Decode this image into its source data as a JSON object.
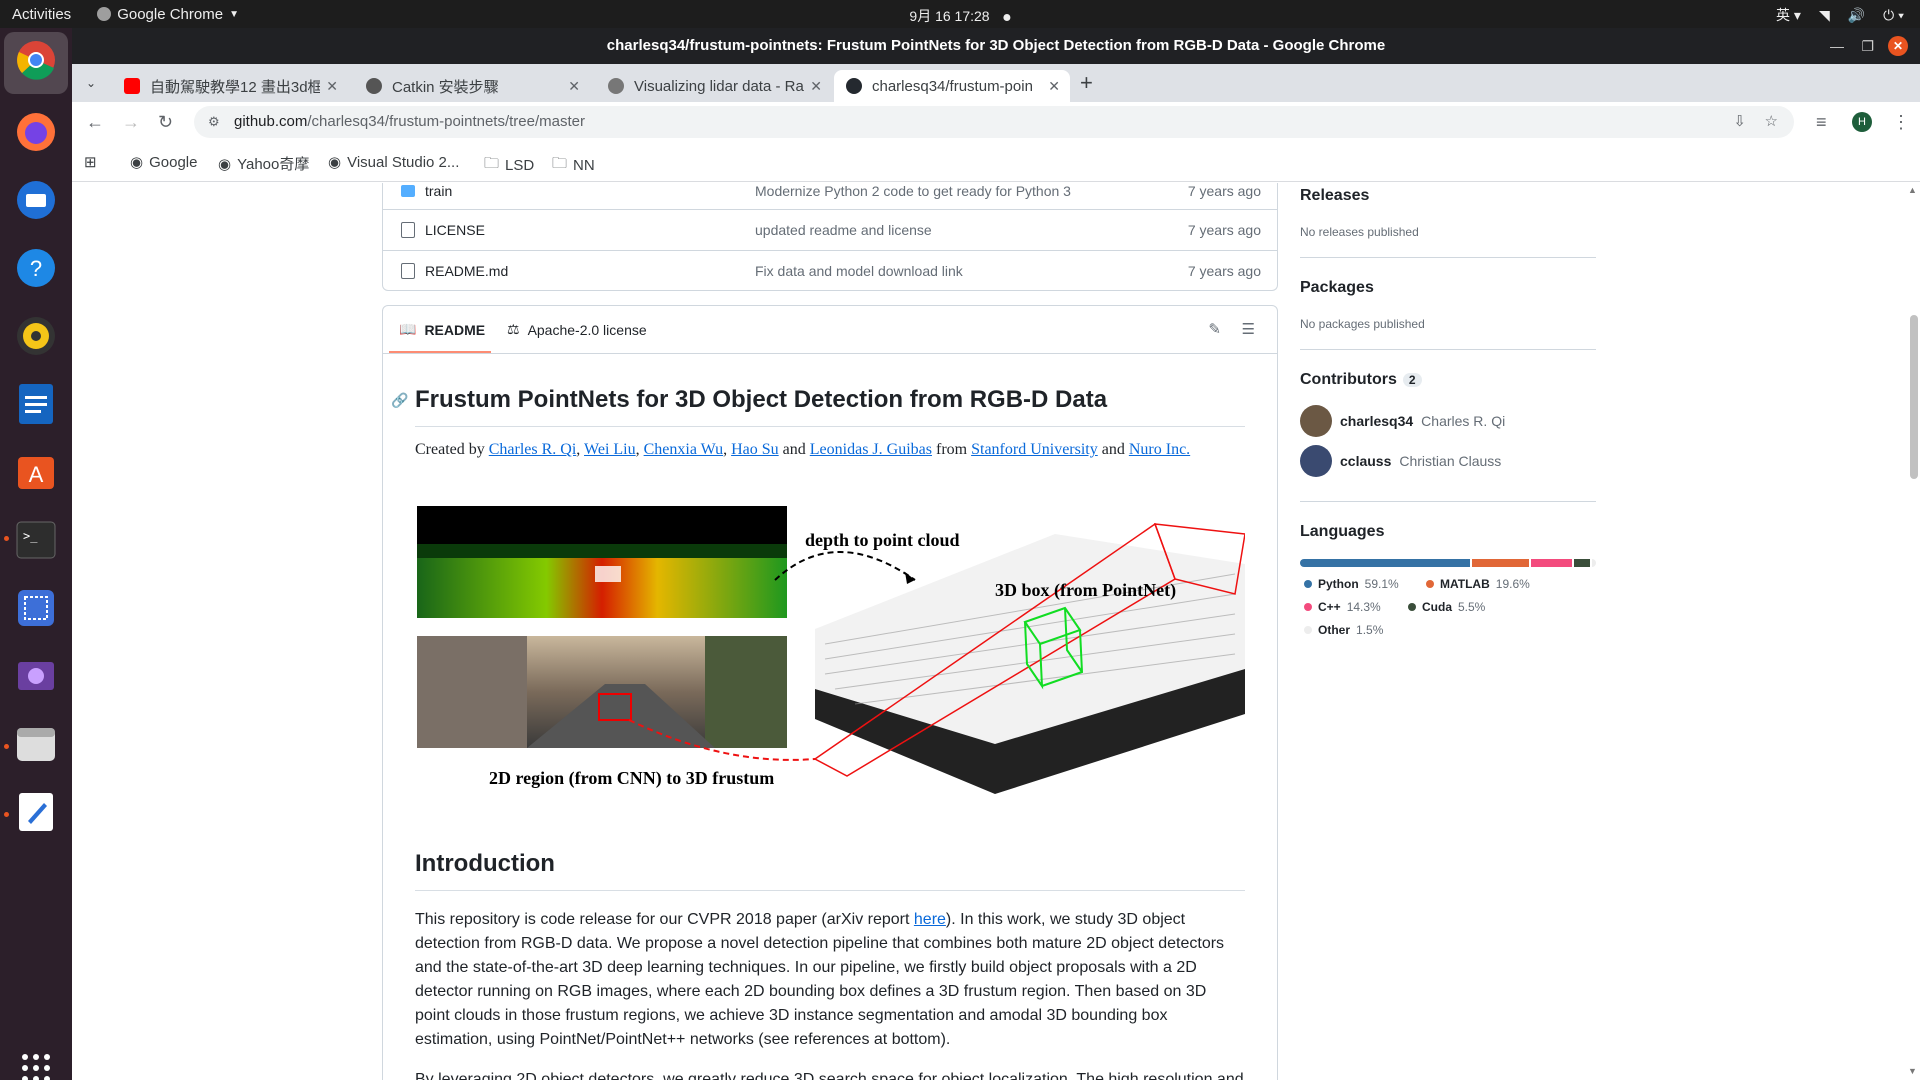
{
  "topbar": {
    "activities": "Activities",
    "app_name": "Google Chrome",
    "clock": "9月 16  17:28",
    "input_method": "英"
  },
  "window": {
    "title": "charlesq34/frustum-pointnets: Frustum PointNets for 3D Object Detection from RGB-D Data - Google Chrome"
  },
  "tabs": [
    {
      "title": "自動駕駛教學12 畫出3d框",
      "icon": "youtube-icon",
      "color": "#ff0000"
    },
    {
      "title": "Catkin 安裝步驟",
      "icon": "catkin-icon",
      "color": "#555555"
    },
    {
      "title": "Visualizing lidar data - Ra",
      "icon": "globe-icon",
      "color": "#777777"
    },
    {
      "title": "charlesq34/frustum-poin",
      "icon": "github-icon",
      "color": "#24292f"
    }
  ],
  "omnibox": {
    "host": "github.com",
    "path": "/charlesq34/frustum-pointnets/tree/master"
  },
  "bookmarks": [
    "Google",
    "Yahoo奇摩",
    "Visual Studio 2...",
    "LSD",
    "NN"
  ],
  "files": [
    {
      "name": "train",
      "message": "Modernize Python 2 code to get ready for Python 3",
      "age": "7 years ago",
      "type": "folder"
    },
    {
      "name": "LICENSE",
      "message": "updated readme and license",
      "age": "7 years ago",
      "type": "file"
    },
    {
      "name": "README.md",
      "message": "Fix data and model download link",
      "age": "7 years ago",
      "type": "file"
    }
  ],
  "readme": {
    "tab_readme": "README",
    "tab_license": "Apache-2.0 license",
    "title": "Frustum PointNets for 3D Object Detection from RGB-D Data",
    "created_by": "Created by",
    "authors": [
      "Charles R. Qi",
      "Wei Liu",
      "Chenxia Wu",
      "Hao Su",
      "Leonidas J. Guibas"
    ],
    "and": "and",
    "from": "from",
    "inst1": "Stanford University",
    "inst2": "Nuro Inc.",
    "figure": {
      "label_depth": "depth to point cloud",
      "label_box": "3D box (from PointNet)",
      "label_region": "2D region (from CNN) to 3D frustum"
    },
    "intro_heading": "Introduction",
    "intro_p1_a": "This repository is code release for our CVPR 2018 paper (arXiv report ",
    "intro_p1_link": "here",
    "intro_p1_b": "). In this work, we study 3D object detection from RGB-D data. We propose a novel detection pipeline that combines both mature 2D object detectors and the state-of-the-art 3D deep learning techniques. In our pipeline, we firstly build object proposals with a 2D detector running on RGB images, where each 2D bounding box defines a 3D frustum region. Then based on 3D point clouds in those frustum regions, we achieve 3D instance segmentation and amodal 3D bounding box estimation, using PointNet/PointNet++ networks (see references at bottom).",
    "intro_p2": "By leveraging 2D object detectors, we greatly reduce 3D search space for object localization. The high resolution and"
  },
  "sidebar": {
    "releases_title": "Releases",
    "releases_text": "No releases published",
    "packages_title": "Packages",
    "packages_text": "No packages published",
    "contributors_title": "Contributors",
    "contributors_count": "2",
    "contributors": [
      {
        "login": "charlesq34",
        "name": "Charles R. Qi"
      },
      {
        "login": "cclauss",
        "name": "Christian Clauss"
      }
    ],
    "languages_title": "Languages",
    "languages": [
      {
        "name": "Python",
        "percent": "59.1%",
        "value": 59.1,
        "color": "#3572A5"
      },
      {
        "name": "MATLAB",
        "percent": "19.6%",
        "value": 19.6,
        "color": "#e16737"
      },
      {
        "name": "C++",
        "percent": "14.3%",
        "value": 14.3,
        "color": "#f34b7d"
      },
      {
        "name": "Cuda",
        "percent": "5.5%",
        "value": 5.5,
        "color": "#3A4E3A"
      },
      {
        "name": "Other",
        "percent": "1.5%",
        "value": 1.5,
        "color": "#ededed"
      }
    ]
  }
}
